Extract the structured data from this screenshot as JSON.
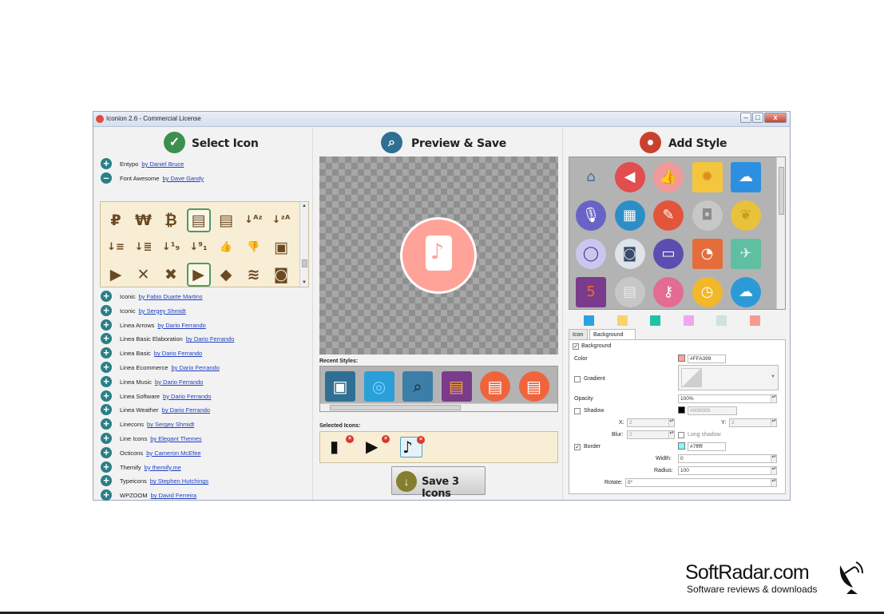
{
  "window": {
    "title": "Iconion 2.6 - Commercial License",
    "min": "–",
    "max": "□",
    "close": "x"
  },
  "panels": {
    "select": {
      "title": "Select Icon",
      "icon": "check-icon"
    },
    "preview": {
      "title": "Preview & Save",
      "icon": "magnifier-icon"
    },
    "style": {
      "title": "Add Style",
      "icon": "drop-icon"
    }
  },
  "packs_top": [
    {
      "name": "Entypo",
      "author": "by Daniel Bruce",
      "toggle": "+"
    },
    {
      "name": "Font Awesome",
      "author": "by Dave Gandy",
      "toggle": "–"
    }
  ],
  "fa_icons": [
    {
      "g": "₽",
      "name": "ruble-icon"
    },
    {
      "g": "₩",
      "name": "won-icon"
    },
    {
      "g": "₿",
      "name": "bitcoin-icon"
    },
    {
      "g": "▤",
      "name": "file-icon",
      "sel": true
    },
    {
      "g": "▤",
      "name": "file-text-icon"
    },
    {
      "g": "↓ᴬᶻ",
      "name": "sort-alpha-asc-icon"
    },
    {
      "g": "↓ᶻᴬ",
      "name": "sort-alpha-desc-icon"
    },
    {
      "g": "↓≡",
      "name": "sort-amount-asc-icon"
    },
    {
      "g": "↓≣",
      "name": "sort-amount-desc-icon"
    },
    {
      "g": "↓¹₉",
      "name": "sort-numeric-asc-icon"
    },
    {
      "g": "↓⁹₁",
      "name": "sort-numeric-desc-icon"
    },
    {
      "g": "👍",
      "name": "thumbs-up-icon"
    },
    {
      "g": "👎",
      "name": "thumbs-down-icon"
    },
    {
      "g": "▣",
      "name": "youtube-square-icon"
    },
    {
      "g": "▶",
      "name": "youtube-icon"
    },
    {
      "g": "✕",
      "name": "xing-icon"
    },
    {
      "g": "✖",
      "name": "xing-square-icon"
    },
    {
      "g": "▶",
      "name": "youtube-play-icon",
      "sel": true
    },
    {
      "g": "◆",
      "name": "dropbox-icon"
    },
    {
      "g": "≋",
      "name": "stack-overflow-icon"
    },
    {
      "g": "◙",
      "name": "instagram-icon"
    }
  ],
  "packs": [
    {
      "name": "Iconic",
      "author": "by Fabio Duarte Martins"
    },
    {
      "name": "Iconic",
      "author": "by Sergey Shmidt"
    },
    {
      "name": "Linea Arrows",
      "author": "by Dario Ferrando"
    },
    {
      "name": "Linea Basic Elaboration",
      "author": "by Dario Ferrando"
    },
    {
      "name": "Linea Basic",
      "author": "by Dario Ferrando"
    },
    {
      "name": "Linea Ecommerce",
      "author": "by Dario Ferrando"
    },
    {
      "name": "Linea Music",
      "author": "by Dario Ferrando"
    },
    {
      "name": "Linea Software",
      "author": "by Dario Ferrando"
    },
    {
      "name": "Linea Weather",
      "author": "by Dario Ferrando"
    },
    {
      "name": "Linecons",
      "author": "by Sergey Shmidt"
    },
    {
      "name": "Line Icons",
      "author": "by Elegant Themes"
    },
    {
      "name": "Octicons",
      "author": "by Cameron McEfee"
    },
    {
      "name": "Themify",
      "author": "by themify.me"
    },
    {
      "name": "Typeicons",
      "author": "by Stephen Hutchings"
    },
    {
      "name": "WPZOOM",
      "author": "by David Ferreira"
    }
  ],
  "preview": {
    "icon": "music-file-icon",
    "fill_color": "#FFA399",
    "note": "♪"
  },
  "recent_label": "Recent Styles:",
  "recent_styles": [
    {
      "name": "image-style-icon",
      "bg": "#2f6f93",
      "fg": "#fff",
      "g": "▣"
    },
    {
      "name": "circle-style-icon",
      "bg": "#2a9fd8",
      "fg": "#7fd4ff",
      "g": "◎"
    },
    {
      "name": "search-style-icon",
      "bg": "#3b7ea8",
      "fg": "#1b1b1b",
      "g": "⌕"
    },
    {
      "name": "doc-style-icon",
      "bg": "#7a3b8c",
      "fg": "#f3a53c",
      "g": "▤"
    },
    {
      "name": "doc-orange-style-icon",
      "bg": "#f0643c",
      "fg": "#fff",
      "g": "▤"
    },
    {
      "name": "doc-ring-style-icon",
      "bg": "#f0643c",
      "fg": "#fff",
      "g": "▤"
    }
  ],
  "selected_label": "Selected Icons:",
  "selected_icons": [
    {
      "name": "selected-file-icon",
      "g": "▮"
    },
    {
      "name": "selected-youtube-icon",
      "g": "▶"
    },
    {
      "name": "selected-music-icon",
      "g": "♪",
      "sel": true
    }
  ],
  "save_button": "Save 3 Icons",
  "style_presets": [
    {
      "name": "home-preset-icon",
      "bg": "#b3b3b3",
      "fg": "#3c6ea8",
      "g": "⌂",
      "shape": "round"
    },
    {
      "name": "speaker-preset-icon",
      "bg": "#e24d4d",
      "fg": "#fff",
      "g": "◀",
      "shape": "round"
    },
    {
      "name": "thumbs-up-preset-icon",
      "bg": "#f29a9a",
      "fg": "#fff",
      "g": "👍",
      "shape": "round"
    },
    {
      "name": "gear-preset-icon",
      "bg": "#f3c63d",
      "fg": "#d98e1e",
      "g": "✹",
      "shape": "square"
    },
    {
      "name": "cloud-preset-icon",
      "bg": "#2d8fe0",
      "fg": "#fff",
      "g": "☁",
      "shape": "square"
    },
    {
      "name": "mic-preset-icon",
      "bg": "#6a63c6",
      "fg": "#fff",
      "g": "🎙",
      "shape": "round"
    },
    {
      "name": "contact-book-preset-icon",
      "bg": "#2b8ec7",
      "fg": "#fff",
      "g": "▦",
      "shape": "round"
    },
    {
      "name": "flashlight-preset-icon",
      "bg": "#e2553b",
      "fg": "#fff",
      "g": "✎",
      "shape": "round"
    },
    {
      "name": "camera-outline-preset-icon",
      "bg": "#c7c7c7",
      "fg": "#8a8a8a",
      "g": "◘",
      "shape": "round"
    },
    {
      "name": "leaf-preset-icon",
      "bg": "#e9c23b",
      "fg": "#c99a1b",
      "g": "❦",
      "shape": "round"
    },
    {
      "name": "bulb-preset-icon",
      "bg": "#c9c7ef",
      "fg": "#3d3a7a",
      "g": "◯",
      "shape": "round"
    },
    {
      "name": "camera-preset-icon",
      "bg": "#dfe3ea",
      "fg": "#3a4a6a",
      "g": "◙",
      "shape": "round"
    },
    {
      "name": "battery-preset-icon",
      "bg": "#5a4fb0",
      "fg": "#fff",
      "g": "▭",
      "shape": "round"
    },
    {
      "name": "pie-chart-preset-icon",
      "bg": "#e46d3b",
      "fg": "#fff",
      "g": "◔",
      "shape": "square"
    },
    {
      "name": "airplane-preset-icon",
      "bg": "#5fbfa0",
      "fg": "#d7f0e7",
      "g": "✈",
      "shape": "square"
    },
    {
      "name": "html5-preset-icon",
      "bg": "#7a3b8c",
      "fg": "#f36a2f",
      "g": "5",
      "shape": "square"
    },
    {
      "name": "notebook-preset-icon",
      "bg": "#c7c7c7",
      "fg": "#e8e8e8",
      "g": "▤",
      "shape": "round"
    },
    {
      "name": "key-preset-icon",
      "bg": "#e46b92",
      "fg": "#fff",
      "g": "⚷",
      "shape": "round"
    },
    {
      "name": "clock-preset-icon",
      "bg": "#f3b72a",
      "fg": "#fff",
      "g": "◷",
      "shape": "round"
    },
    {
      "name": "cloud-upload-preset-icon",
      "bg": "#2d9ad8",
      "fg": "#fff",
      "g": "☁",
      "shape": "round"
    }
  ],
  "swatches": [
    "#2aa3e0",
    "#f6d36b",
    "#20c2a7",
    "#f0a7f0",
    "#cfe2dc",
    "#f79a8f"
  ],
  "tabs": {
    "icon": "Icon",
    "background": "Background"
  },
  "props": {
    "background": "Background",
    "color": "Color",
    "color_value": "#FFA399",
    "gradient": "Gradient",
    "opacity": "Opacity",
    "opacity_value": "100%",
    "shadow": "Shadow",
    "shadow_value": "#000000",
    "x_label": "X:",
    "x_value": "2",
    "y_label": "Y:",
    "y_value": "2",
    "blur_label": "Blur:",
    "blur_value": "2",
    "long_shadow": "Long shadow",
    "border": "Border",
    "border_value": "#7fffff",
    "width_label": "Width:",
    "width_value": "0",
    "radius_label": "Radius:",
    "radius_value": "100",
    "rotate_label": "Rotate:",
    "rotate_value": "0°",
    "check": "✓"
  },
  "watermark": {
    "name": "SoftRadar.com",
    "tagline": "Software reviews & downloads"
  }
}
